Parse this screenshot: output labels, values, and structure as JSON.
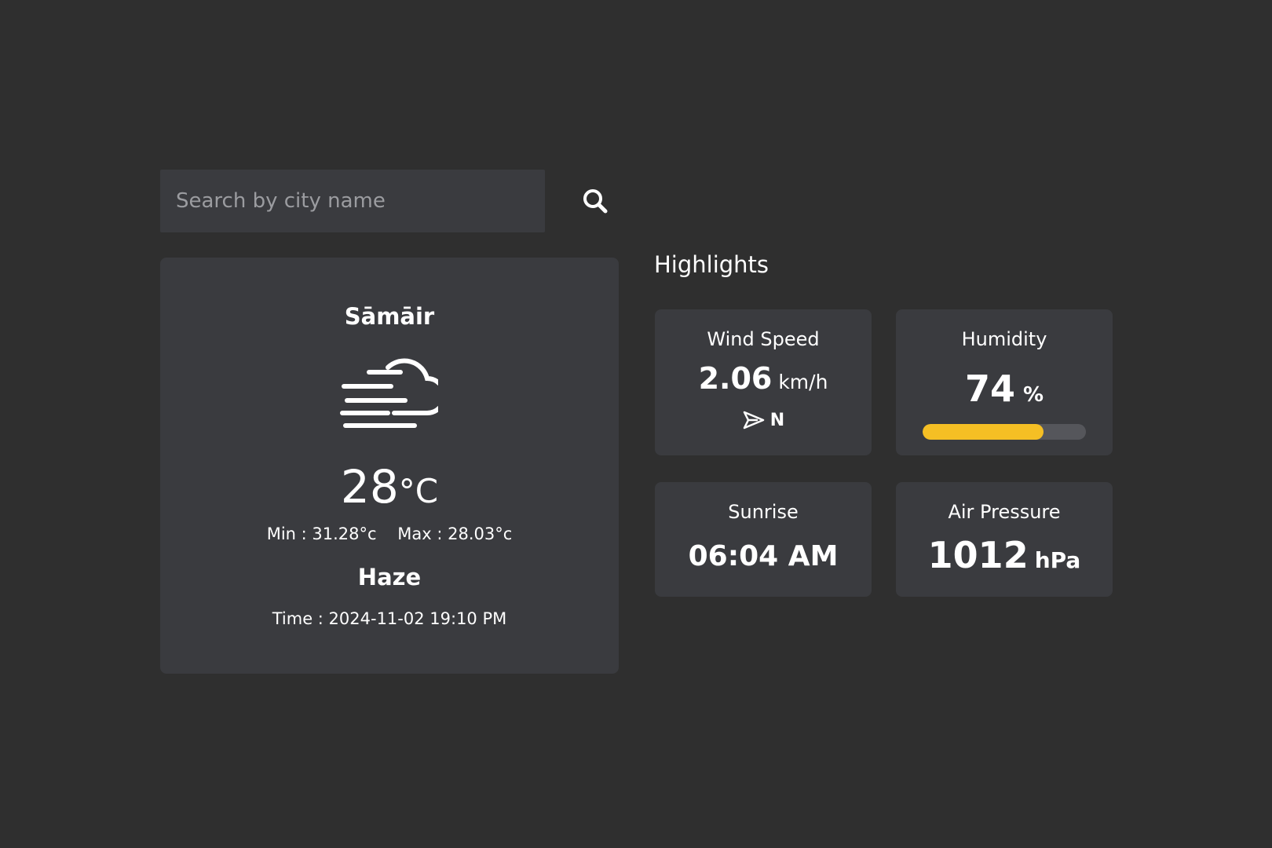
{
  "search": {
    "placeholder": "Search by city name",
    "value": "",
    "button_icon": "search-icon"
  },
  "current": {
    "city": "Sāmāir",
    "icon": "haze-cloud-icon",
    "temperature": "28",
    "temperature_unit": "°C",
    "min_text": "Min : 31.28°c",
    "max_text": "Max : 28.03°c",
    "condition": "Haze",
    "time_text": "Time : 2024-11-02 19:10 PM"
  },
  "highlights": {
    "title": "Highlights",
    "wind": {
      "label": "Wind Speed",
      "value": "2.06",
      "unit": "km/h",
      "direction": "N",
      "direction_icon": "navigation-arrow-icon"
    },
    "humidity": {
      "label": "Humidity",
      "value": "74",
      "unit": "%",
      "percent": 74
    },
    "sunrise": {
      "label": "Sunrise",
      "value": "06:04 AM"
    },
    "pressure": {
      "label": "Air Pressure",
      "value": "1012",
      "unit": "hPa"
    }
  },
  "colors": {
    "background": "#2f2f2f",
    "card": "#3a3b3f",
    "accent": "#f5bf24",
    "track": "#55565b"
  }
}
